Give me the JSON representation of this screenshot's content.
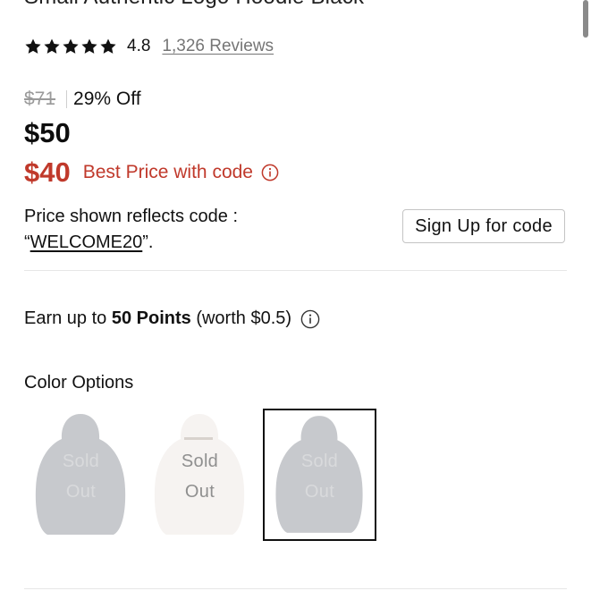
{
  "product": {
    "title_cut": "Small Authentic Logo Hoodie Black"
  },
  "rating": {
    "stars_count": 5,
    "value": "4.8",
    "reviews_link": "1,326 Reviews"
  },
  "pricing": {
    "original_price": "$71",
    "discount": "29% Off",
    "current_price": "$50",
    "best_price": "$40",
    "best_price_label": "Best Price with code",
    "code_text_line1": "Price shown reflects code :",
    "code_open_quote": "“",
    "code": "WELCOME20",
    "code_close": "”.",
    "signup_label": "Sign Up for code"
  },
  "points": {
    "prefix": "Earn up to ",
    "amount": "50 Points",
    "suffix": " (worth $0.5)"
  },
  "color_options": {
    "title": "Color Options",
    "swatches": [
      {
        "line1": "Sold",
        "line2": "Out",
        "selected": false
      },
      {
        "line1": "Sold",
        "line2": "Out",
        "selected": false
      },
      {
        "line1": "Sold",
        "line2": "Out",
        "selected": true
      }
    ]
  },
  "colors": {
    "accent_red": "#c0392b",
    "muted_gray": "#757575",
    "hoodie_gray": "#c7c9cd",
    "hoodie_white": "#f6f3f1"
  }
}
